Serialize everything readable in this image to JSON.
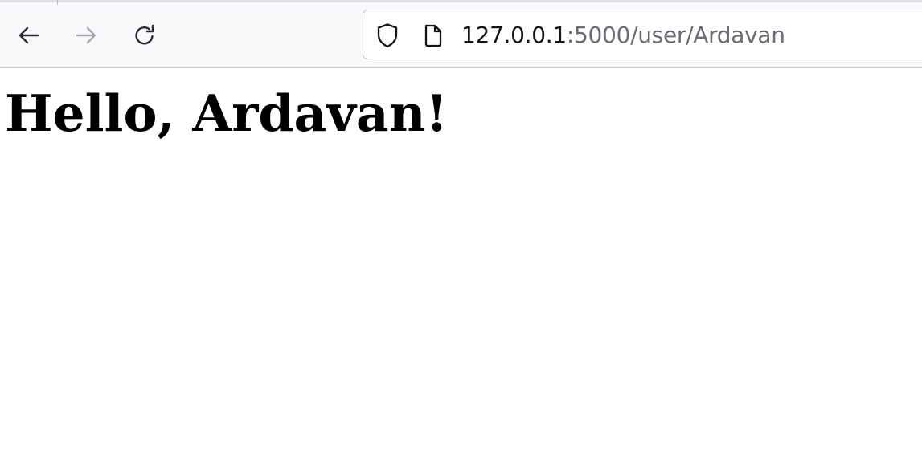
{
  "browser": {
    "nav": {
      "back_icon": "arrow-left-icon",
      "forward_icon": "arrow-right-icon",
      "reload_icon": "reload-icon"
    },
    "urlbar": {
      "shield_icon": "shield-icon",
      "page_icon": "page-icon",
      "host": "127.0.0.1",
      "path": ":5000/user/Ardavan"
    }
  },
  "page": {
    "heading": "Hello, Ardavan!"
  },
  "colors": {
    "toolbar_bg": "#f9f9fb",
    "url_host": "#15141a",
    "url_path": "#6b6b75",
    "forward_disabled": "#a8a8b0"
  }
}
